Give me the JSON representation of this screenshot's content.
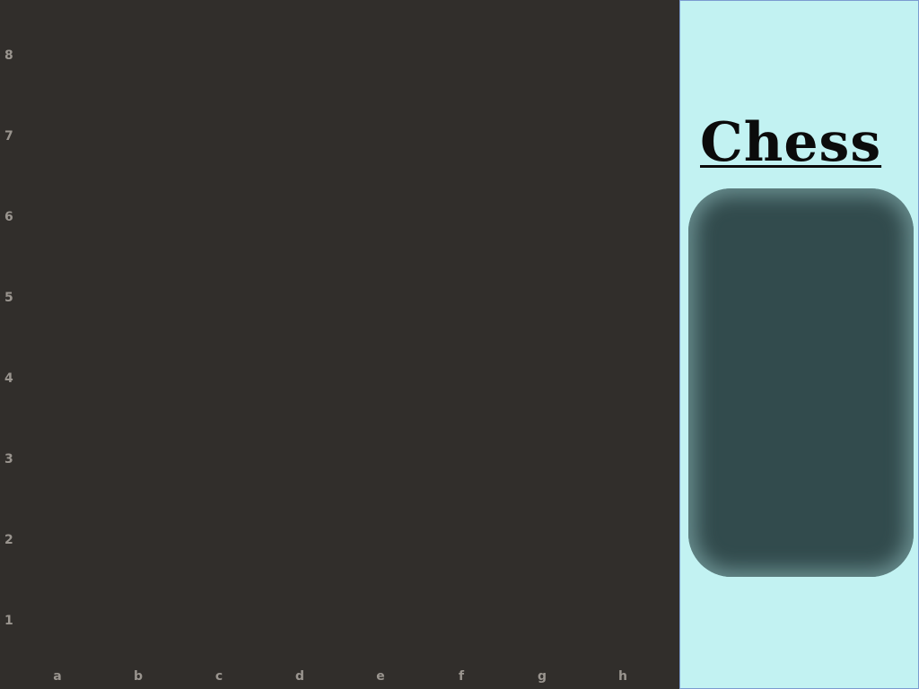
{
  "board": {
    "ranks": [
      "8",
      "7",
      "6",
      "5",
      "4",
      "3",
      "2",
      "1"
    ],
    "files": [
      "a",
      "b",
      "c",
      "d",
      "e",
      "f",
      "g",
      "h"
    ]
  },
  "panel": {
    "title": "Chess"
  },
  "colors": {
    "board_background": "#312e2b",
    "coordinate_text": "#9a958f",
    "panel_background": "#c2f2f2",
    "moves_box_background": "#324b4d"
  }
}
